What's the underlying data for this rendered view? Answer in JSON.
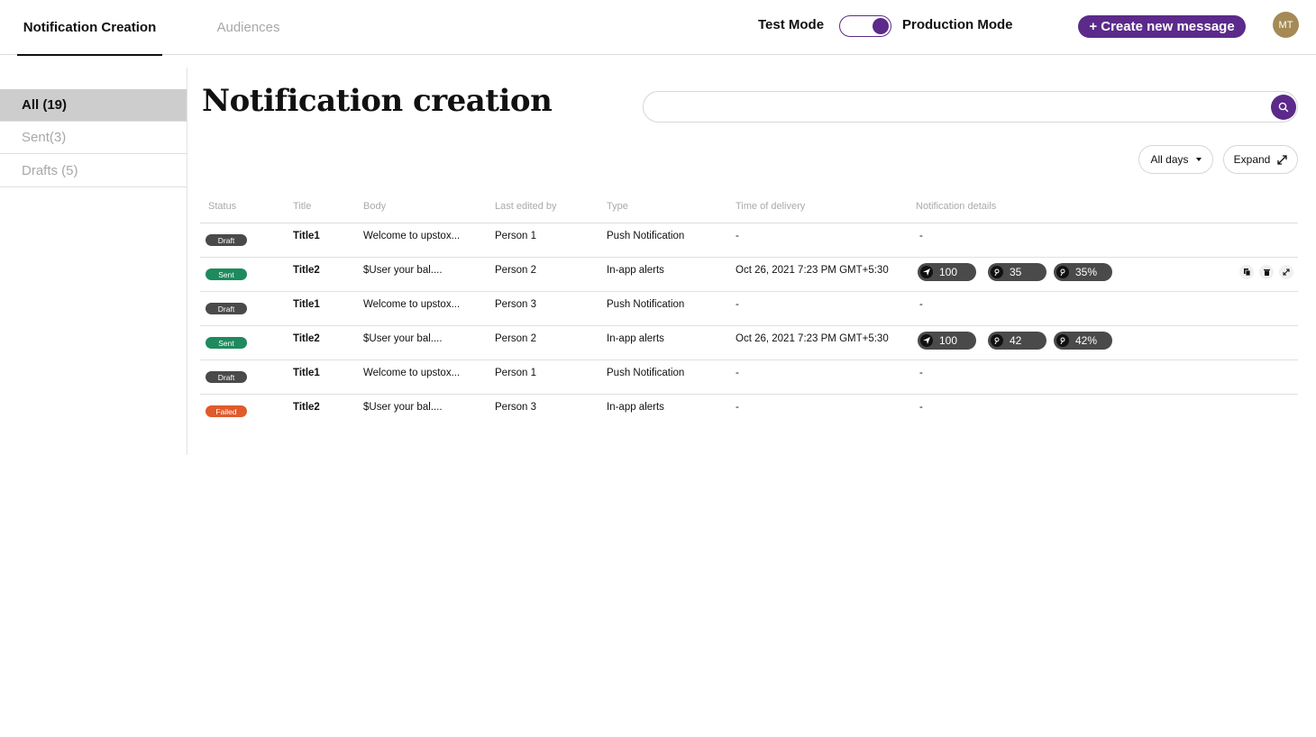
{
  "header": {
    "tabs": [
      {
        "label": "Notification Creation",
        "active": true
      },
      {
        "label": "Audiences",
        "active": false
      }
    ],
    "test_mode_label": "Test Mode",
    "production_mode_label": "Production Mode",
    "mode": "production",
    "create_button_label": "+ Create new message",
    "avatar_initials": "MT"
  },
  "sidebar": {
    "items": [
      {
        "label": "All (19)",
        "active": true
      },
      {
        "label": "Sent(3)",
        "active": false
      },
      {
        "label": "Drafts (5)",
        "active": false
      }
    ]
  },
  "main": {
    "title": "Notification creation",
    "search_value": "",
    "filter_label": "All days",
    "expand_label": "Expand"
  },
  "colors": {
    "accent": "#5b2a8a",
    "draft": "#4a4a4a",
    "sent": "#1e8a5e",
    "failed": "#e05a2b"
  },
  "table": {
    "columns": [
      "Status",
      "Title",
      "Body",
      "Last edited by",
      "Type",
      "Time of delivery",
      "Notification details"
    ],
    "rows": [
      {
        "status": "Draft",
        "title": "Title1",
        "body": "Welcome to upstox...",
        "editor": "Person 1",
        "type": "Push Notification",
        "time": "-",
        "details_text": "-"
      },
      {
        "status": "Sent",
        "title": "Title2",
        "body": "$User your bal....",
        "editor": "Person 2",
        "type": "In-app alerts",
        "time": "Oct 26, 2021 7:23 PM GMT+5:30",
        "details": {
          "sent": "100",
          "opened": "35",
          "rate": "35%"
        },
        "actions": [
          "copy-icon",
          "delete-icon",
          "expand-icon"
        ]
      },
      {
        "status": "Draft",
        "title": "Title1",
        "body": "Welcome to upstox...",
        "editor": "Person 3",
        "type": "Push Notification",
        "time": "-",
        "details_text": "-"
      },
      {
        "status": "Sent",
        "title": "Title2",
        "body": "$User your bal....",
        "editor": "Person 2",
        "type": "In-app alerts",
        "time": "Oct 26, 2021 7:23 PM GMT+5:30",
        "details": {
          "sent": "100",
          "opened": "42",
          "rate": "42%"
        }
      },
      {
        "status": "Draft",
        "title": "Title1",
        "body": "Welcome to upstox...",
        "editor": "Person 1",
        "type": "Push Notification",
        "time": "-",
        "details_text": "-"
      },
      {
        "status": "Failed",
        "title": "Title2",
        "body": "$User your bal....",
        "editor": "Person 3",
        "type": "In-app alerts",
        "time": "-",
        "details_text": "-"
      }
    ]
  }
}
